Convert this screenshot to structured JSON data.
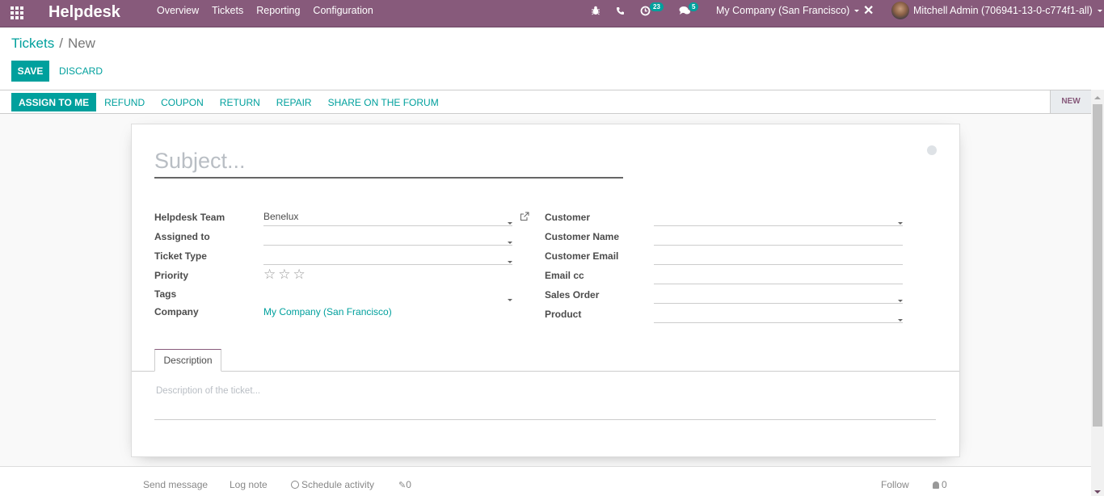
{
  "navbar": {
    "brand": "Helpdesk",
    "menu": [
      "Overview",
      "Tickets",
      "Reporting",
      "Configuration"
    ],
    "activity_count": "23",
    "message_count": "5",
    "company": "My Company (San Francisco)",
    "user": "Mitchell Admin (706941-13-0-c774f1-all)",
    "icons": {
      "apps": "apps-grid-icon",
      "debug": "bug-icon",
      "phone": "phone-icon",
      "activity": "clock-icon",
      "messages": "comments-icon",
      "close": "close-icon"
    }
  },
  "breadcrumb": {
    "parent": "Tickets",
    "separator": "/",
    "current": "New"
  },
  "buttons": {
    "save": "SAVE",
    "discard": "DISCARD"
  },
  "statusbar": {
    "actions": [
      "ASSIGN TO ME",
      "REFUND",
      "COUPON",
      "RETURN",
      "REPAIR",
      "SHARE ON THE FORUM"
    ],
    "stage": "NEW"
  },
  "form": {
    "subject_placeholder": "Subject...",
    "left_fields": {
      "helpdesk_team": {
        "label": "Helpdesk Team",
        "value": "Benelux"
      },
      "assigned_to": {
        "label": "Assigned to",
        "value": ""
      },
      "ticket_type": {
        "label": "Ticket Type",
        "value": ""
      },
      "priority": {
        "label": "Priority",
        "stars_filled": 0,
        "stars_total": 3
      },
      "tags": {
        "label": "Tags",
        "value": ""
      },
      "company": {
        "label": "Company",
        "value": "My Company (San Francisco)"
      }
    },
    "right_fields": {
      "customer": {
        "label": "Customer",
        "value": ""
      },
      "customer_name": {
        "label": "Customer Name",
        "value": ""
      },
      "customer_email": {
        "label": "Customer Email",
        "value": ""
      },
      "email_cc": {
        "label": "Email cc",
        "value": ""
      },
      "sales_order": {
        "label": "Sales Order",
        "value": ""
      },
      "product": {
        "label": "Product",
        "value": ""
      }
    },
    "tabs": [
      "Description"
    ],
    "description_placeholder": "Description of the ticket..."
  },
  "chatter": {
    "send_message": "Send message",
    "log_note": "Log note",
    "schedule_activity": "Schedule activity",
    "attachments": "0",
    "follow": "Follow",
    "followers": "0"
  },
  "colors": {
    "brand": "#875a7b",
    "accent": "#00a09d"
  }
}
